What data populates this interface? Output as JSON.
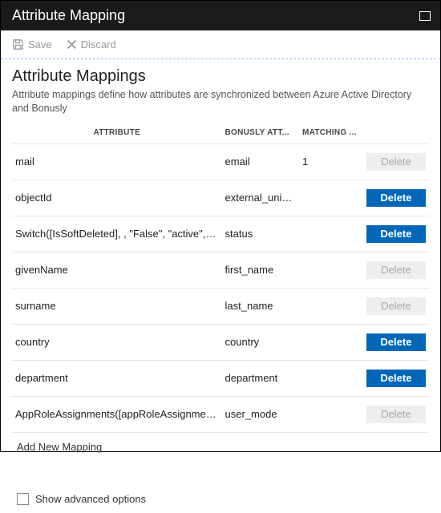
{
  "title": "Attribute Mapping",
  "toolbar": {
    "save": "Save",
    "discard": "Discard"
  },
  "section": {
    "heading": "Attribute Mappings",
    "description": "Attribute mappings define how attributes are synchronized between Azure Active Directory and Bonusly"
  },
  "columns": {
    "attribute": "ATTRIBUTE",
    "bonusly": "BONUSLY ATT...",
    "matching": "MATCHING ..."
  },
  "rows": [
    {
      "attribute": "mail",
      "bonusly": "email",
      "matching": "1",
      "delete_enabled": false
    },
    {
      "attribute": "objectId",
      "bonusly": "external_uniq...",
      "matching": "",
      "delete_enabled": true
    },
    {
      "attribute": "Switch([IsSoftDeleted], , \"False\", \"active\", \"True",
      "bonusly": "status",
      "matching": "",
      "delete_enabled": true
    },
    {
      "attribute": "givenName",
      "bonusly": "first_name",
      "matching": "",
      "delete_enabled": false
    },
    {
      "attribute": "surname",
      "bonusly": "last_name",
      "matching": "",
      "delete_enabled": false
    },
    {
      "attribute": "country",
      "bonusly": "country",
      "matching": "",
      "delete_enabled": true
    },
    {
      "attribute": "department",
      "bonusly": "department",
      "matching": "",
      "delete_enabled": true
    },
    {
      "attribute": "AppRoleAssignments([appRoleAssignments])",
      "bonusly": "user_mode",
      "matching": "",
      "delete_enabled": false
    }
  ],
  "delete_label": "Delete",
  "add_new": "Add New Mapping",
  "advanced_label": "Show advanced options"
}
